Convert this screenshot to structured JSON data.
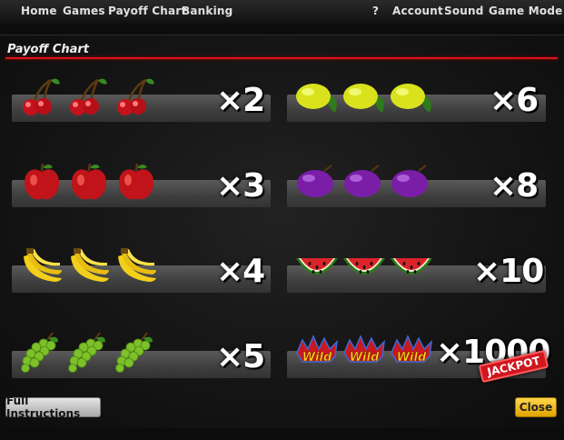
{
  "nav": {
    "home": "Home",
    "games": "Games",
    "payoff_chart": "Payoff Chart",
    "banking": "Banking",
    "help": "?",
    "account": "Account",
    "sound": "Sound",
    "game_mode": "Game Mode"
  },
  "panel": {
    "title": "Payoff Chart",
    "accent_color": "#d8141c"
  },
  "payouts": [
    {
      "symbol": "cherry",
      "multiplier": "×2"
    },
    {
      "symbol": "apple",
      "multiplier": "×3"
    },
    {
      "symbol": "banana",
      "multiplier": "×4"
    },
    {
      "symbol": "grapes",
      "multiplier": "×5"
    },
    {
      "symbol": "lemon",
      "multiplier": "×6"
    },
    {
      "symbol": "plum",
      "multiplier": "×8"
    },
    {
      "symbol": "watermelon",
      "multiplier": "×10"
    },
    {
      "symbol": "wild",
      "multiplier": "×1000"
    }
  ],
  "wild_symbol_text": "Wild",
  "jackpot_label": "JACKPOT",
  "buttons": {
    "full_instructions": "Full Instructions",
    "close": "Close"
  }
}
